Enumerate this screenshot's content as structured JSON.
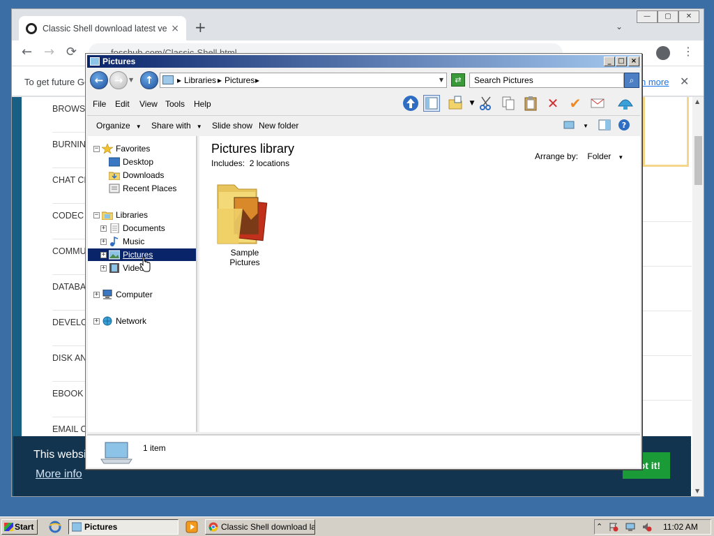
{
  "browser": {
    "tab_title": "Classic Shell download latest ver",
    "tab_close": "×",
    "new_tab": "+",
    "tab_dropdown": "⌄",
    "win_min": "—",
    "win_max": "▢",
    "win_close": "✕",
    "back": "←",
    "forward": "→",
    "reload": "⟳",
    "url": "fosshub.com/Classic-Shell.html",
    "menu": "⋮",
    "infobar_text": "To get future Go",
    "infobar_link": "n more",
    "infobar_close": "✕",
    "categories": [
      "BROWS",
      "BURNIN",
      "CHAT CI",
      "CODEC I",
      "COMMU",
      "DATABA",
      "DEVELO",
      "DISK AN",
      "EBOOK",
      "EMAIL C"
    ],
    "cookie_text": "This websi",
    "cookie_more": "More info",
    "cookie_button": "ot it!"
  },
  "explorer": {
    "title": "Pictures",
    "titlebar_buttons": {
      "minimize": "_",
      "maximize": "□",
      "close": "×"
    },
    "breadcrumbs": [
      "Libraries",
      "Pictures"
    ],
    "search_placeholder": "Search Pictures",
    "menu": [
      "File",
      "Edit",
      "View",
      "Tools",
      "Help"
    ],
    "commands": {
      "organize": "Organize",
      "share_with": "Share with",
      "slide_show": "Slide show",
      "new_folder": "New folder"
    },
    "nav": {
      "favorites": "Favorites",
      "desktop": "Desktop",
      "downloads": "Downloads",
      "recent_places": "Recent Places",
      "libraries": "Libraries",
      "documents": "Documents",
      "music": "Music",
      "pictures": "Pictures",
      "videos": "Videos",
      "computer": "Computer",
      "network": "Network"
    },
    "content": {
      "title": "Pictures library",
      "includes_label": "Includes:",
      "includes_link": "2 locations",
      "arrange_label": "Arrange by:",
      "arrange_value": "Folder",
      "folder_name": "Sample Pictures"
    },
    "status": "1 item"
  },
  "taskbar": {
    "start": "Start",
    "task_explorer": "Pictures",
    "task_chrome": "Classic Shell download la...",
    "clock": "11:02 AM"
  }
}
